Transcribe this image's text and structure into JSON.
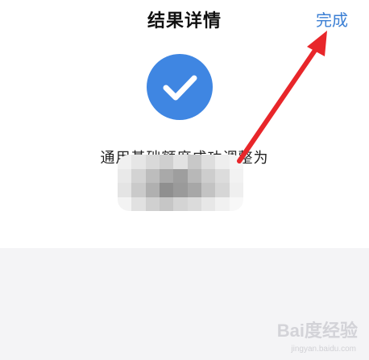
{
  "header": {
    "title": "结果详情",
    "done_label": "完成"
  },
  "result": {
    "message": "通用基础额度成功调整为",
    "amount_visible": "000"
  },
  "colors": {
    "accent": "#3b7fd4",
    "check_circle": "#3f86e2",
    "annotation_arrow": "#e8262a"
  },
  "watermark": {
    "main": "Bai度经验",
    "sub": "jingyan.baidu.com"
  }
}
